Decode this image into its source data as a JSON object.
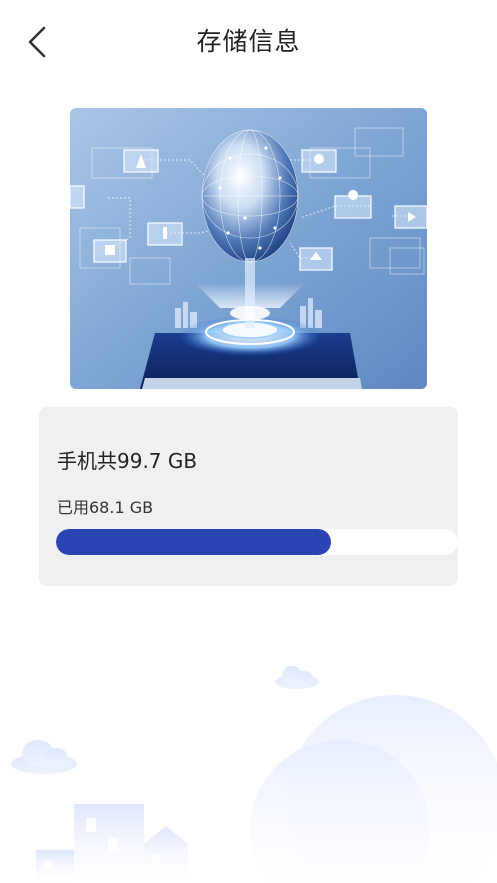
{
  "header": {
    "title": "存储信息"
  },
  "storage": {
    "total_label": "手机共99.7 GB",
    "used_label": "已用68.1 GB",
    "total_gb": 99.7,
    "used_gb": 68.1,
    "used_fraction": 0.683
  },
  "colors": {
    "accent": "#2a44b3",
    "card_bg": "#f0f0f0"
  },
  "icons": {
    "back": "chevron-left-icon"
  }
}
